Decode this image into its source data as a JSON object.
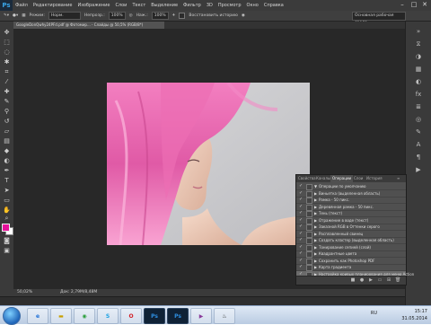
{
  "menu": {
    "logo": "Ps",
    "items": [
      "Файл",
      "Редактирование",
      "Изображение",
      "Слои",
      "Текст",
      "Выделение",
      "Фильтр",
      "3D",
      "Просмотр",
      "Окно",
      "Справка"
    ]
  },
  "options": {
    "mode_label": "Режим:",
    "mode_value": "Норм.",
    "opacity_label": "Непрозр.:",
    "opacity_value": "100%",
    "flow_label": "Наж.:",
    "flow_value": "100%",
    "airbrush_label": "Восстановить историю",
    "workspace": "Основная рабочая среда"
  },
  "document": {
    "tab_title": "GoogleDonQwhy24PFd.pdf @ Фотомир... - Слайды @ 50,5% (RGB/8*)",
    "zoom": "50,02%",
    "doc_size": "Док: 2,79М/8,48М"
  },
  "panel": {
    "tabs": [
      "Свойства",
      "Каналы",
      "Операции",
      "Слои",
      "История"
    ],
    "active_tab": "Операции",
    "actions": [
      {
        "label": "Операции по умолчанию",
        "expanded": true,
        "selected": false
      },
      {
        "label": "Виньетка (выделенная область)",
        "expanded": false,
        "selected": false
      },
      {
        "label": "Рамка - 50 пикс.",
        "expanded": false,
        "selected": false
      },
      {
        "label": "Деревянная рамка - 50 пикс.",
        "expanded": false,
        "selected": false
      },
      {
        "label": "Тень (текст)",
        "expanded": false,
        "selected": false
      },
      {
        "label": "Отражение в воде (текст)",
        "expanded": false,
        "selected": false
      },
      {
        "label": "Заказной RGB в Оттенки серого",
        "expanded": false,
        "selected": false
      },
      {
        "label": "Расплавленный свинец",
        "expanded": false,
        "selected": false
      },
      {
        "label": "Создать кластер (выделенная область)",
        "expanded": false,
        "selected": false
      },
      {
        "label": "Тонирование сепией (слой)",
        "expanded": false,
        "selected": false
      },
      {
        "label": "Квадрантные цвета",
        "expanded": false,
        "selected": false
      },
      {
        "label": "Сохранить как Photoshop PDF",
        "expanded": false,
        "selected": false
      },
      {
        "label": "Карта градиента",
        "expanded": false,
        "selected": false
      },
      {
        "label": "Настройка кривых планирования для меню Action",
        "expanded": false,
        "selected": true
      }
    ]
  },
  "taskbar": {
    "apps": [
      "ie",
      "folder",
      "chrome",
      "skype",
      "opera",
      "ps",
      "ps",
      "media",
      "steam"
    ],
    "lang": "RU",
    "time": "15:17",
    "date": "31.05.2014"
  },
  "colors": {
    "foreground": "#e6109a",
    "background": "#ffffff",
    "app_bg": "#282828"
  }
}
